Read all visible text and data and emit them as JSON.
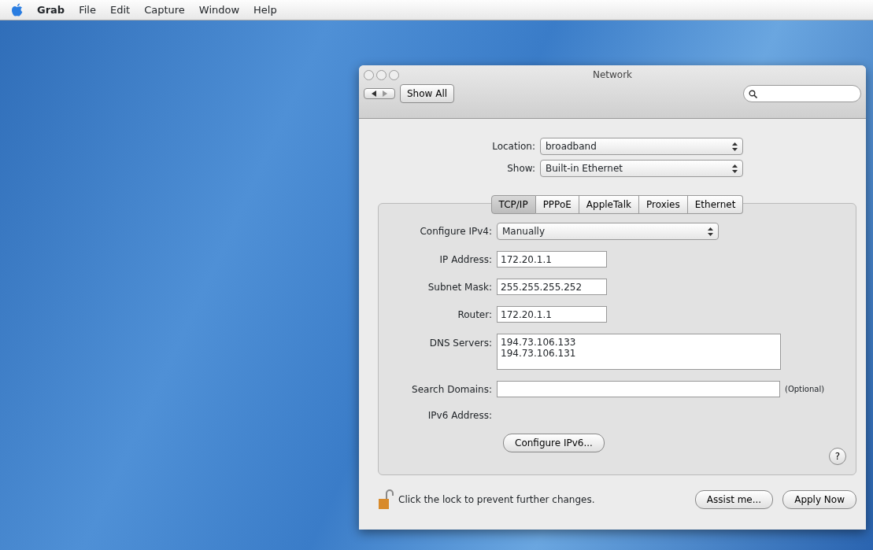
{
  "menu_bar": {
    "app_name": "Grab",
    "items": [
      "File",
      "Edit",
      "Capture",
      "Window",
      "Help"
    ]
  },
  "window": {
    "title": "Network",
    "show_all": "Show All"
  },
  "selectors": [
    {
      "label": "Location:",
      "value": "broadband"
    },
    {
      "label": "Show:",
      "value": "Built-in Ethernet"
    }
  ],
  "tabs": [
    {
      "label": "TCP/IP",
      "selected": true
    },
    {
      "label": "PPPoE",
      "selected": false
    },
    {
      "label": "AppleTalk",
      "selected": false
    },
    {
      "label": "Proxies",
      "selected": false
    },
    {
      "label": "Ethernet",
      "selected": false
    }
  ],
  "fields": [
    {
      "kind": "select",
      "label": "Configure IPv4:",
      "value": "Manually"
    },
    {
      "kind": "text",
      "label": "IP Address:",
      "value": "172.20.1.1"
    },
    {
      "kind": "text",
      "label": "Subnet Mask:",
      "value": "255.255.255.252"
    },
    {
      "kind": "text",
      "label": "Router:",
      "value": "172.20.1.1"
    },
    {
      "kind": "textarea",
      "label": "DNS Servers:",
      "lines": [
        "194.73.106.133",
        "194.73.106.131"
      ]
    },
    {
      "kind": "wide",
      "label": "Search Domains:",
      "note": "(Optional)"
    },
    {
      "kind": "static",
      "label": "IPv6 Address:"
    }
  ],
  "configure_button": "Configure IPv6...",
  "help": "?",
  "lock_text": "Click the lock to prevent further changes.",
  "buttons": [
    "Assist me...",
    "Apply Now"
  ]
}
